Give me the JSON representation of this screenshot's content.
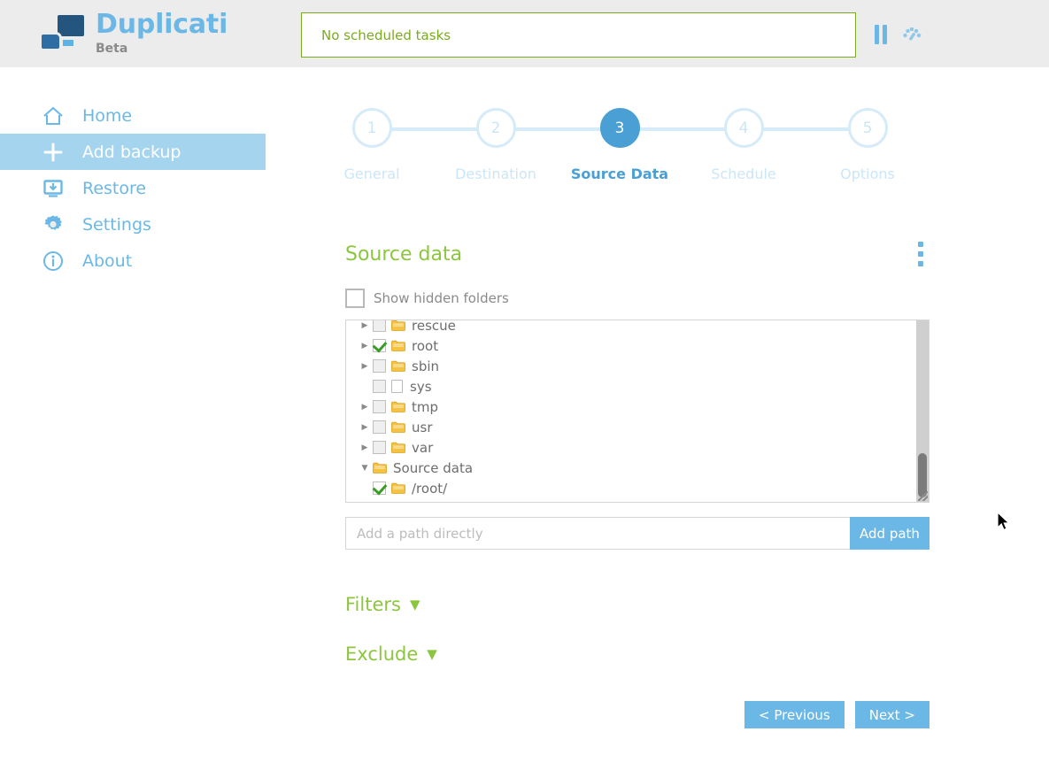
{
  "app": {
    "brand_title": "Duplicati",
    "brand_subtitle": "Beta",
    "logo_icon": "duplicati-logo-icon"
  },
  "header": {
    "status_text": "No scheduled tasks",
    "status_border_color": "#7aab1f",
    "status_text_color": "#7aab1f",
    "pause_icon": "pause-icon",
    "throttle_icon": "throttle-icon"
  },
  "sidebar": {
    "items": [
      {
        "label": "Home",
        "icon": "home-icon",
        "active": false
      },
      {
        "label": "Add backup",
        "icon": "plus-icon",
        "active": true
      },
      {
        "label": "Restore",
        "icon": "restore-icon",
        "active": false
      },
      {
        "label": "Settings",
        "icon": "gear-icon",
        "active": false
      },
      {
        "label": "About",
        "icon": "info-icon",
        "active": false
      }
    ],
    "active_background": "#a5d4ef",
    "link_color": "#6bb8e6"
  },
  "wizard": {
    "active_step": 3,
    "steps": [
      {
        "number": "1",
        "label": "General"
      },
      {
        "number": "2",
        "label": "Destination"
      },
      {
        "number": "3",
        "label": "Source Data"
      },
      {
        "number": "4",
        "label": "Schedule"
      },
      {
        "number": "5",
        "label": "Options"
      }
    ],
    "active_color": "#4a9fd4",
    "inactive_color": "#cbe6f7"
  },
  "panel": {
    "title": "Source data",
    "title_color": "#8cc63e",
    "menu_icon": "kebab-menu-icon",
    "show_hidden_label": "Show hidden folders",
    "show_hidden_checked": false
  },
  "tree": {
    "nodes": [
      {
        "name": "rescue",
        "type": "folder",
        "checked": false,
        "expandable": true,
        "expanded": false,
        "indent": 0
      },
      {
        "name": "root",
        "type": "folder",
        "checked": true,
        "expandable": true,
        "expanded": false,
        "indent": 0
      },
      {
        "name": "sbin",
        "type": "folder",
        "checked": false,
        "expandable": true,
        "expanded": false,
        "indent": 0
      },
      {
        "name": "sys",
        "type": "file",
        "checked": false,
        "expandable": false,
        "expanded": false,
        "indent": 0
      },
      {
        "name": "tmp",
        "type": "folder",
        "checked": false,
        "expandable": true,
        "expanded": false,
        "indent": 0
      },
      {
        "name": "usr",
        "type": "folder",
        "checked": false,
        "expandable": true,
        "expanded": false,
        "indent": 0
      },
      {
        "name": "var",
        "type": "folder",
        "checked": false,
        "expandable": true,
        "expanded": false,
        "indent": 0
      },
      {
        "name": "Source data",
        "type": "group",
        "checked": null,
        "expandable": true,
        "expanded": true,
        "indent": 0
      },
      {
        "name": "/root/",
        "type": "folder",
        "checked": true,
        "expandable": false,
        "expanded": false,
        "indent": 1
      }
    ],
    "scroll_position": "near-bottom"
  },
  "path_entry": {
    "placeholder": "Add a path directly",
    "value": "",
    "button_label": "Add path"
  },
  "sections": [
    {
      "label": "Filters",
      "expanded": false,
      "chevron": "chevron-down-icon"
    },
    {
      "label": "Exclude",
      "expanded": false,
      "chevron": "chevron-down-icon"
    }
  ],
  "footer": {
    "previous_label": "< Previous",
    "next_label": "Next >"
  }
}
